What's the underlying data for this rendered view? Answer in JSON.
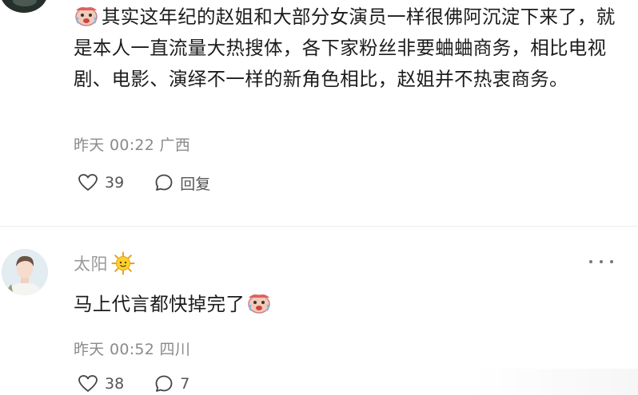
{
  "comments": [
    {
      "text": "其实这年纪的赵姐和大部分女演员一样很佛阿沉淀下来了，就是本人一直流量大热搜体，各下家粉丝非要蛐蛐商务，相比电视剧、电影、演绎不一样的新角色相比，赵姐并不热衷商务。",
      "lead_emoji": "crying-laughing-emoji",
      "meta": "昨天 00:22 广西",
      "likes": "39",
      "reply_label": "回复"
    },
    {
      "username": "太阳",
      "username_emoji": "sun-emoji",
      "text": "马上代言都快掉完了",
      "trail_emoji": "crying-laughing-emoji",
      "meta": "昨天 00:52 四川",
      "likes": "38",
      "replies": "7"
    }
  ],
  "colors": {
    "text": "#1c1c1c",
    "meta": "#8a8a8a",
    "username": "#9a9a9a",
    "divider": "#ebebeb"
  }
}
